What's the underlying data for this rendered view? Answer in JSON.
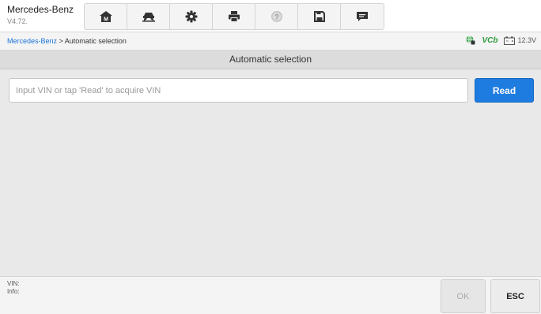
{
  "header": {
    "app_title": "Mercedes-Benz",
    "version": "V4.72.",
    "toolbar": [
      {
        "icon": "home-icon"
      },
      {
        "icon": "car-lift-icon"
      },
      {
        "icon": "gear-icon"
      },
      {
        "icon": "printer-icon"
      },
      {
        "icon": "help-icon"
      },
      {
        "icon": "save-icon"
      },
      {
        "icon": "message-icon"
      }
    ]
  },
  "breadcrumb": {
    "link": "Mercedes-Benz",
    "separator": " > ",
    "current": "Automatic selection"
  },
  "status": {
    "vcb": "VCb",
    "voltage": "12.3V"
  },
  "page_title": "Automatic selection",
  "vin": {
    "placeholder": "Input VIN or tap 'Read' to acquire VIN",
    "value": "",
    "read_label": "Read"
  },
  "footer": {
    "vin_label": "VIN:",
    "info_label": "Info:",
    "ok_label": "OK",
    "esc_label": "ESC"
  },
  "colors": {
    "accent": "#1e7ce0",
    "vcb_green": "#2a9a3a"
  }
}
